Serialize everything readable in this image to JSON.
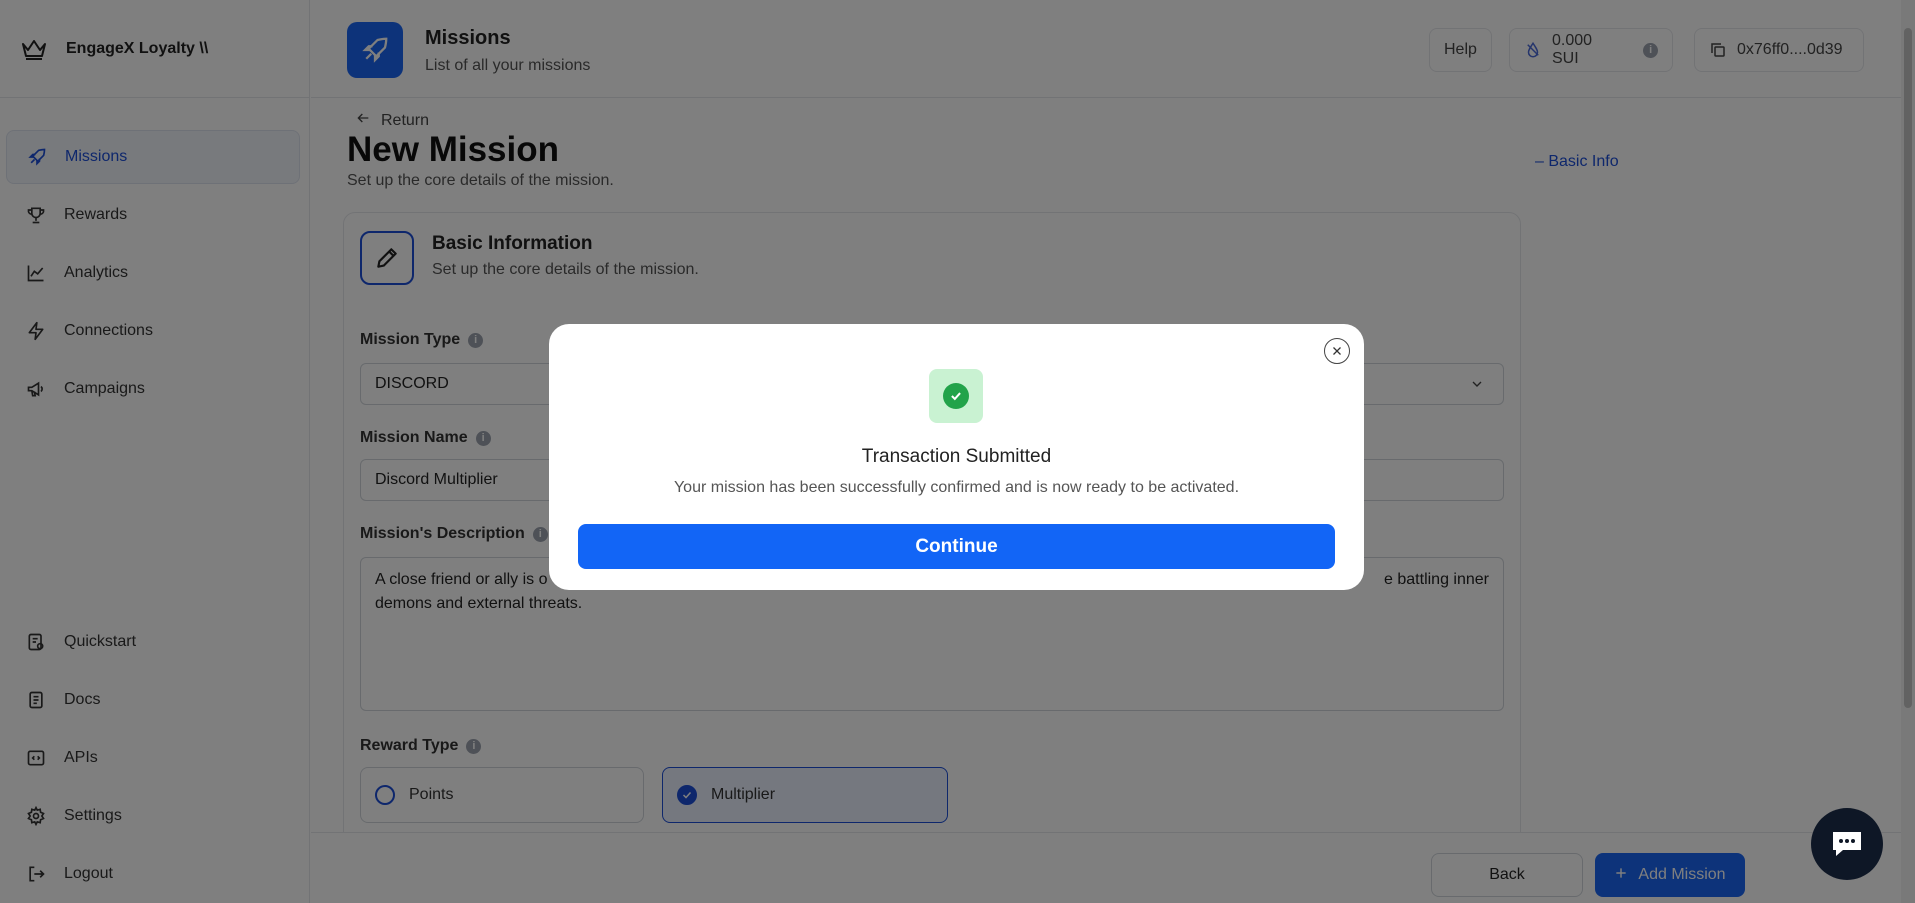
{
  "app": {
    "brand_name": "EngageX Loyalty \\\\"
  },
  "sidebar": {
    "items": [
      {
        "label": "Missions",
        "icon": "rocket-icon",
        "active": true
      },
      {
        "label": "Rewards",
        "icon": "trophy-icon"
      },
      {
        "label": "Analytics",
        "icon": "chart-line-icon"
      },
      {
        "label": "Connections",
        "icon": "lightning-icon"
      },
      {
        "label": "Campaigns",
        "icon": "megaphone-icon"
      }
    ],
    "bottom_items": [
      {
        "label": "Quickstart",
        "icon": "quickstart-icon"
      },
      {
        "label": "Docs",
        "icon": "document-icon"
      },
      {
        "label": "APIs",
        "icon": "code-icon"
      },
      {
        "label": "Settings",
        "icon": "gear-icon"
      },
      {
        "label": "Logout",
        "icon": "logout-icon"
      }
    ]
  },
  "header": {
    "title": "Missions",
    "subtitle": "List of all your missions",
    "help_label": "Help",
    "balance": "0.000 SUI",
    "wallet": "0x76ff0....0d39"
  },
  "page": {
    "return_label": "Return",
    "title": "New Mission",
    "subtitle": "Set up the core details of the mission.",
    "toc_link": "– Basic Info"
  },
  "card": {
    "title": "Basic Information",
    "subtitle": "Set up the core details of the mission.",
    "mission_type_label": "Mission Type",
    "mission_type_value": "DISCORD",
    "mission_name_label": "Mission Name",
    "mission_name_value": "Discord Multiplier",
    "description_label": "Mission's Description",
    "description_start": "A close friend or ally is o",
    "description_end": "e battling inner",
    "description_line2": "demons and external threats.",
    "reward_type_label": "Reward Type",
    "reward_options": [
      {
        "label": "Points",
        "selected": false
      },
      {
        "label": "Multiplier",
        "selected": true
      }
    ]
  },
  "footer": {
    "back_label": "Back",
    "add_label": "Add Mission"
  },
  "modal": {
    "title": "Transaction Submitted",
    "message": "Your mission has been successfully confirmed and is now ready to be activated.",
    "continue_label": "Continue"
  },
  "colors": {
    "primary": "#1265f6",
    "success": "#22a34a",
    "success_bg": "#c9f2d2",
    "overlay": "rgba(0,0,0,0.5)"
  }
}
